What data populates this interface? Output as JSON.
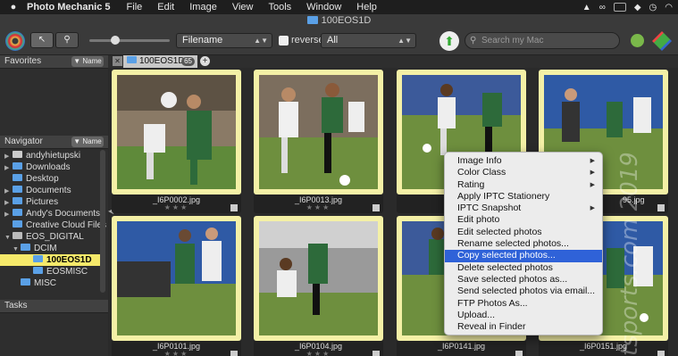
{
  "menubar": {
    "app_name": "Photo Mechanic 5",
    "items": [
      "File",
      "Edit",
      "Image",
      "View",
      "Tools",
      "Window",
      "Help"
    ]
  },
  "window": {
    "title": "100EOS1D"
  },
  "toolbar": {
    "sort_value": "Filename",
    "reverse_label": "reverse",
    "filter_value": "All",
    "search_placeholder": "Search my Mac"
  },
  "favorites": {
    "title": "Favorites",
    "name_button": "Name"
  },
  "navigator": {
    "title": "Navigator",
    "name_button": "Name",
    "items": [
      {
        "label": "andyhietupski",
        "kind": "home"
      },
      {
        "label": "Downloads",
        "kind": "folder"
      },
      {
        "label": "Desktop",
        "kind": "folder"
      },
      {
        "label": "Documents",
        "kind": "folder"
      },
      {
        "label": "Pictures",
        "kind": "folder"
      },
      {
        "label": "Andy's Documents",
        "kind": "folder"
      },
      {
        "label": "Creative Cloud Files",
        "kind": "folder"
      },
      {
        "label": "EOS_DIGITAL",
        "kind": "drive"
      },
      {
        "label": "DCIM",
        "kind": "folder"
      },
      {
        "label": "100EOS1D",
        "kind": "folder",
        "selected": true
      },
      {
        "label": "EOSMISC",
        "kind": "folder"
      },
      {
        "label": "MISC",
        "kind": "folder"
      }
    ]
  },
  "tasks": {
    "title": "Tasks"
  },
  "tab": {
    "label": "100EOS1D",
    "count": "65"
  },
  "photos": [
    {
      "filename": "_I6P0002.jpg"
    },
    {
      "filename": "_I6P0013.jpg"
    },
    {
      "filename": ""
    },
    {
      "filename": "95.jpg"
    },
    {
      "filename": "_I6P0101.jpg"
    },
    {
      "filename": "_I6P0104.jpg"
    },
    {
      "filename": "_I6P0141.jpg"
    },
    {
      "filename": "_I6P0151.jpg"
    }
  ],
  "context_menu": {
    "items": [
      {
        "label": "Image Info",
        "submenu": true
      },
      {
        "label": "Color Class",
        "submenu": true
      },
      {
        "label": "Rating",
        "submenu": true
      },
      {
        "label": "Apply IPTC Stationery",
        "submenu": false
      },
      {
        "label": "IPTC Snapshot",
        "submenu": true
      },
      {
        "label": "Edit photo",
        "submenu": false
      },
      {
        "label": "Edit selected photos",
        "submenu": false
      },
      {
        "label": "Rename selected photos...",
        "submenu": false
      },
      {
        "label": "Copy selected photos...",
        "submenu": false,
        "highlighted": true
      },
      {
        "label": "Delete selected photos",
        "submenu": false
      },
      {
        "label": "Save selected photos as...",
        "submenu": false
      },
      {
        "label": "Send selected photos via email...",
        "submenu": false
      },
      {
        "label": "FTP Photos As...",
        "submenu": false
      },
      {
        "label": "Upload...",
        "submenu": false
      },
      {
        "label": "Reveal in Finder",
        "submenu": false
      }
    ]
  },
  "watermark": "tsports.com 2019",
  "colors": {
    "thumb_bg": "#f4f0a6",
    "highlight": "#2f62d8",
    "selected_folder": "#f5e96a"
  }
}
